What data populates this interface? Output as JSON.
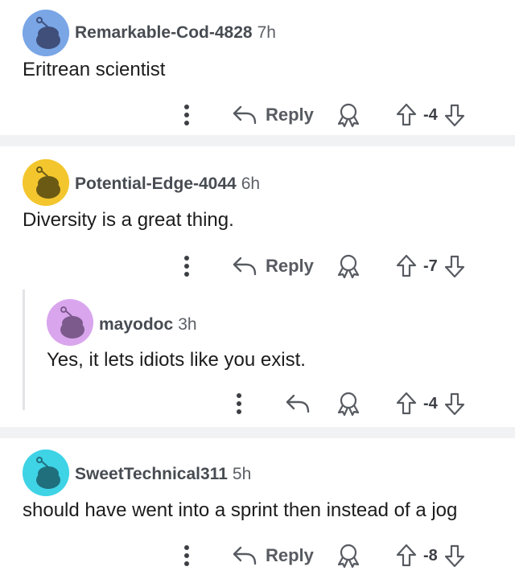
{
  "comments": [
    {
      "username": "Remarkable-Cod-4828",
      "age": "7h",
      "text": "Eritrean scientist",
      "avatar_color": "#7aa6e6",
      "reply_label": "Reply",
      "score": "-4"
    },
    {
      "username": "Potential-Edge-4044",
      "age": "6h",
      "text": "Diversity is a great thing.",
      "avatar_color": "#f3c62e",
      "reply_label": "Reply",
      "score": "-7"
    },
    {
      "username": "mayodoc",
      "age": "3h",
      "text": "Yes, it lets idiots like you exist.",
      "avatar_color": "#d9a6ee",
      "reply_label": "",
      "score": "-4"
    },
    {
      "username": "SweetTechnical311",
      "age": "5h",
      "text": "should have went into a sprint then instead of a jog",
      "avatar_color": "#3fd3e6",
      "reply_label": "Reply",
      "score": "-8"
    }
  ],
  "icons": {
    "more": "more-options-icon",
    "reply": "reply-arrow-icon",
    "award": "award-icon",
    "upvote": "upvote-arrow-icon",
    "downvote": "downvote-arrow-icon"
  },
  "colors": {
    "separator": "#f1f2f4",
    "thread_line": "#e2e4e7",
    "action_gray": "#575b61"
  }
}
